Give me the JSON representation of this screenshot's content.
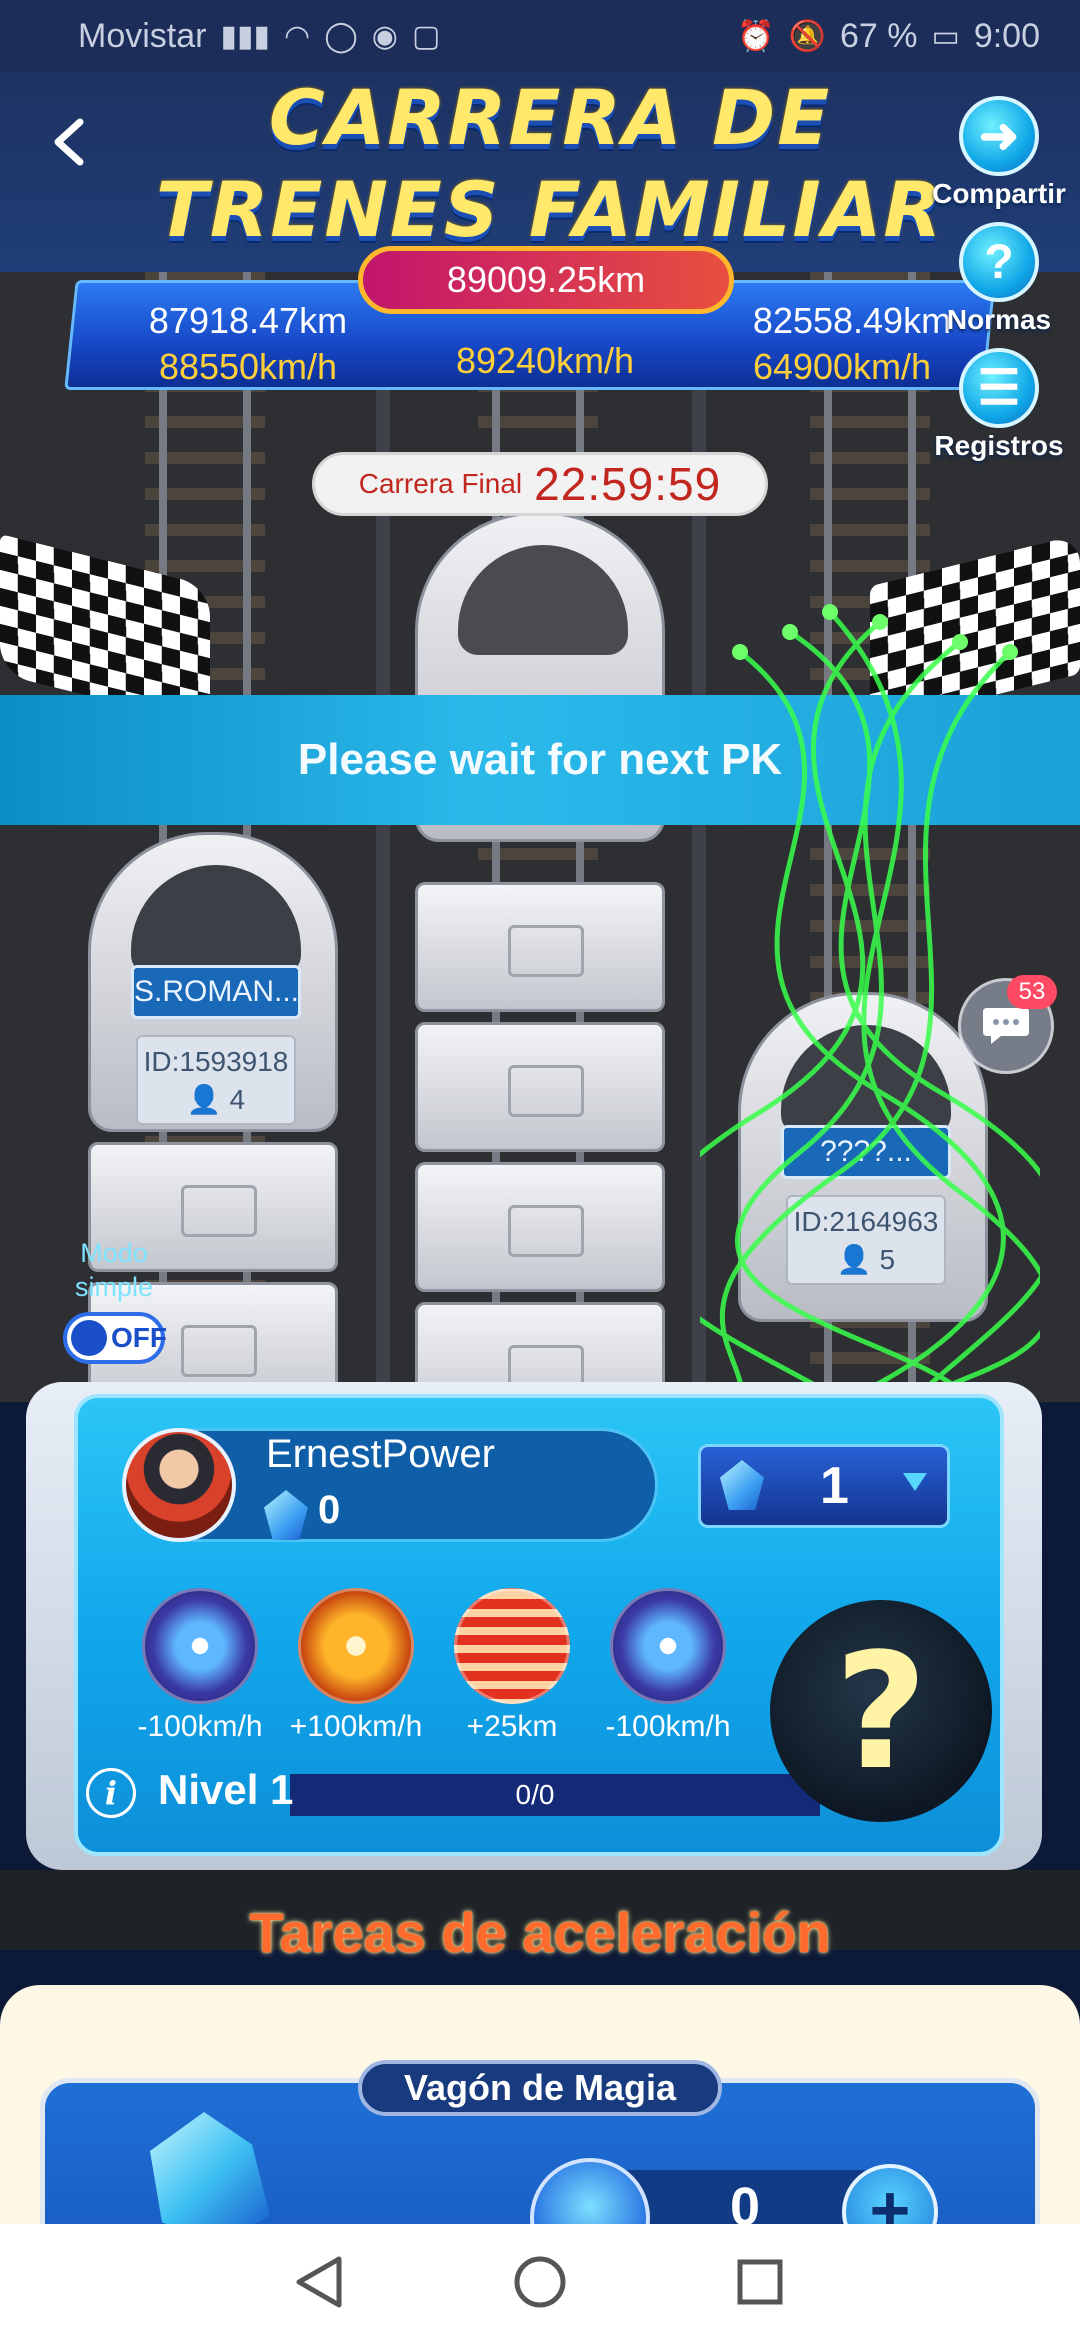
{
  "status_bar": {
    "carrier": "Movistar",
    "battery": "67 %",
    "time": "9:00"
  },
  "header": {
    "title_line1": "CARRERA DE",
    "title_line2": "TRENES FAMILIAR"
  },
  "side_buttons": {
    "share": "Compartir",
    "rules": "Normas",
    "records": "Registros"
  },
  "scoreboard": {
    "center_distance": "89009.25km",
    "left_distance": "87918.47km",
    "left_speed": "88550km/h",
    "center_speed": "89240km/h",
    "right_distance": "82558.49km",
    "right_speed": "64900km/h"
  },
  "timer": {
    "label": "Carrera Final",
    "value": "22:59:59"
  },
  "banner": {
    "text": "Please wait for next PK"
  },
  "trains": {
    "left_name": "S.ROMAN...",
    "left_id": "ID:1593918",
    "left_members": "4",
    "right_name": "????...",
    "right_id": "ID:2164963",
    "right_members": "5"
  },
  "chat": {
    "badge": "53"
  },
  "simple_mode": {
    "label_line1": "Modo",
    "label_line2": "simple",
    "toggle_text": "OFF"
  },
  "player": {
    "name": "ErnestPower",
    "gems": "0",
    "selected_gems": "1"
  },
  "skills": [
    {
      "label": "-100km/h",
      "icon": "blue-burst-icon"
    },
    {
      "label": "+100km/h",
      "icon": "orange-burst-icon"
    },
    {
      "label": "+25km",
      "icon": "red-spring-icon"
    },
    {
      "label": "-100km/h",
      "icon": "blue-burst-icon"
    }
  ],
  "level": {
    "label": "Nivel 1",
    "progress_text": "0/0",
    "progress_fraction": 0
  },
  "tasks": {
    "title": "Tareas de aceleración",
    "magic_card_title": "Vagón de Magia",
    "magic_count": "0"
  },
  "colors": {
    "title_yellow": "#ffe86a",
    "panel_blue": "#11a8ec",
    "tasks_orange": "#ff6a2d",
    "timer_red": "#c1271f"
  }
}
